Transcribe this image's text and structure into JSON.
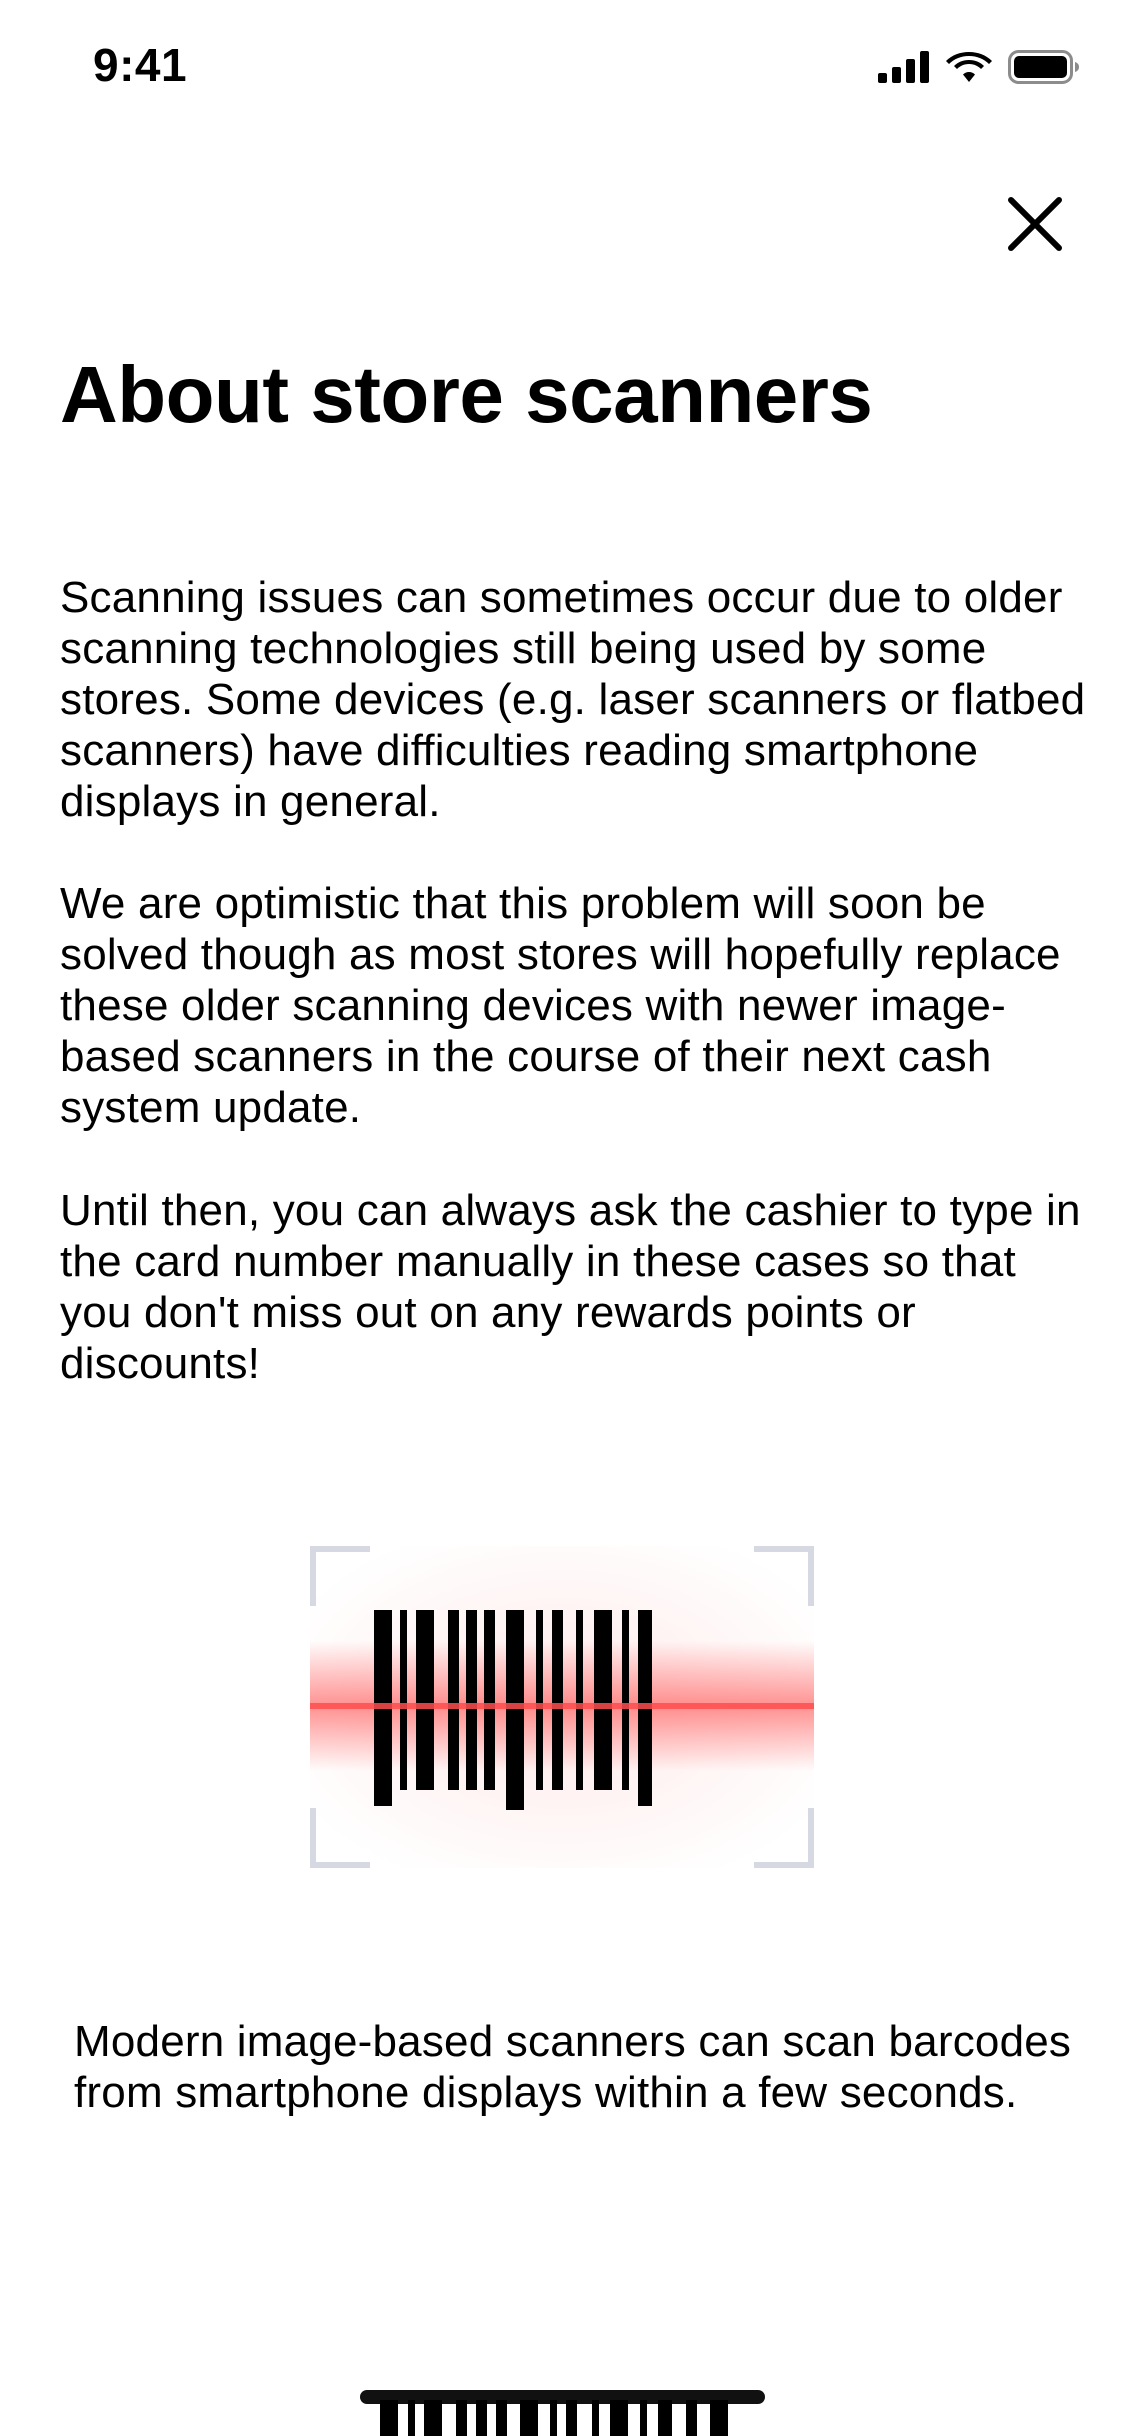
{
  "status_bar": {
    "time": "9:41"
  },
  "header": {
    "title": "About store scanners"
  },
  "content": {
    "paragraphs": [
      "Scanning issues can sometimes occur due to older scanning technologies still being used by some stores. Some devices (e.g. laser scanners or flatbed scanners) have difficulties reading smartphone displays in general.",
      "We are optimistic that this problem will soon be solved though as most stores will hopefully replace these older scanning devices with newer image-based scanners in the course of their next cash system update.",
      "Until then, you can always ask the cashier to type in the card number manually in these cases so that you don't miss out on any rewards points or discounts!"
    ],
    "illustration_caption": "Modern image-based scanners can scan barcodes from smartphone displays within a few seconds."
  },
  "colors": {
    "scan_line": "#ff3b3b",
    "corner_brackets": "#d6d8e2",
    "text": "#000000",
    "background": "#ffffff"
  },
  "icons": [
    "cellular-signal-icon",
    "wifi-icon",
    "battery-icon",
    "close-icon",
    "barcode-scanner-illustration"
  ]
}
